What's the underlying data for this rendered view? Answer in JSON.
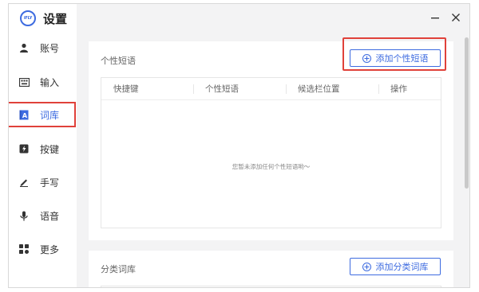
{
  "app": {
    "logo_text": "iFLY",
    "title": "设置"
  },
  "window_controls": {
    "minimize_symbol": "—",
    "close_symbol": "✕"
  },
  "sidebar": {
    "items": [
      {
        "label": "账号",
        "icon": "user-icon"
      },
      {
        "label": "输入",
        "icon": "keyboard-icon"
      },
      {
        "label": "词库",
        "icon": "dictionary-icon",
        "active": true
      },
      {
        "label": "按键",
        "icon": "key-icon"
      },
      {
        "label": "手写",
        "icon": "pen-icon"
      },
      {
        "label": "语音",
        "icon": "microphone-icon"
      },
      {
        "label": "更多",
        "icon": "grid-icon"
      }
    ]
  },
  "phrases": {
    "title": "个性短语",
    "add_label": "添加个性短语",
    "columns": [
      "快捷键",
      "个性短语",
      "候选栏位置",
      "操作"
    ],
    "empty_text": "您暂未添加任何个性短语哟～"
  },
  "categories": {
    "title": "分类词库",
    "add_label": "添加分类词库"
  },
  "colors": {
    "accent": "#3d6be0",
    "highlight": "#e0413a"
  }
}
